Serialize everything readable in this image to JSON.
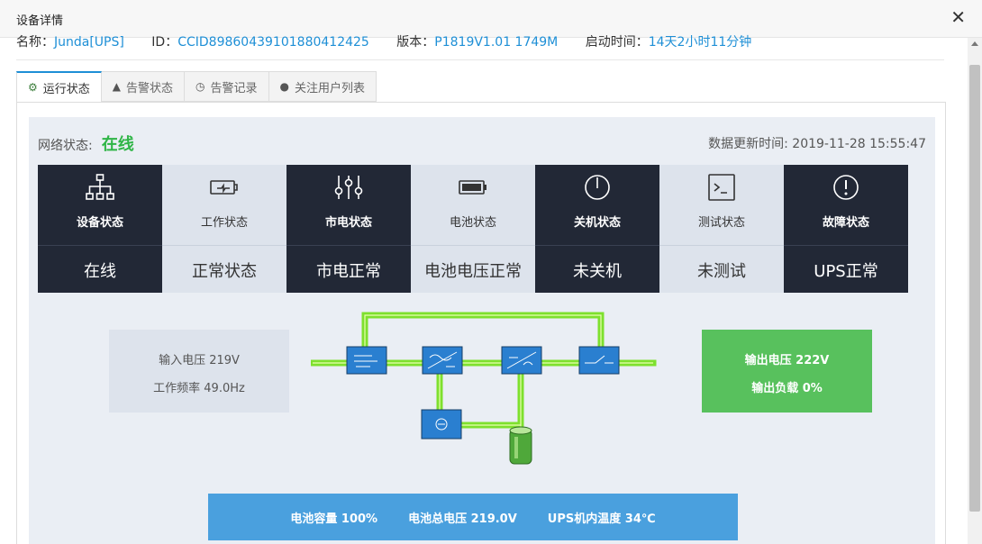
{
  "window": {
    "title": "设备详情",
    "close_icon": "close-icon"
  },
  "info": [
    {
      "label": "名称：",
      "value": "Junda[UPS]"
    },
    {
      "label": "ID：",
      "value": "CCID89860439101880412425"
    },
    {
      "label": "版本：",
      "value": "P1819V1.01 1749M"
    },
    {
      "label": "启动时间：",
      "value": "14天2小时11分钟"
    }
  ],
  "tabs": [
    {
      "label": "运行状态",
      "icon": "gears-icon"
    },
    {
      "label": "告警状态",
      "icon": "warning-icon"
    },
    {
      "label": "告警记录",
      "icon": "clock-icon"
    },
    {
      "label": "关注用户列表",
      "icon": "wechat-icon"
    }
  ],
  "network": {
    "label": "网络状态:",
    "value": "在线"
  },
  "update_time": "数据更新时间: 2019-11-28 15:55:47",
  "status_cells": [
    {
      "label": "设备状态",
      "value": "在线",
      "icon": "sitemap-icon",
      "theme": "dark"
    },
    {
      "label": "工作状态",
      "value": "正常状态",
      "icon": "battery-charge-icon",
      "theme": "light"
    },
    {
      "label": "市电状态",
      "value": "市电正常",
      "icon": "sliders-icon",
      "theme": "dark"
    },
    {
      "label": "电池状态",
      "value": "电池电压正常",
      "icon": "battery-icon",
      "theme": "light"
    },
    {
      "label": "关机状态",
      "value": "未关机",
      "icon": "power-icon",
      "theme": "dark"
    },
    {
      "label": "测试状态",
      "value": "未测试",
      "icon": "terminal-icon",
      "theme": "light"
    },
    {
      "label": "故障状态",
      "value": "UPS正常",
      "icon": "alert-circle-icon",
      "theme": "dark"
    }
  ],
  "input": {
    "voltage": "输入电压  219V",
    "frequency": "工作频率  49.0Hz"
  },
  "output": {
    "voltage": "输出电压  222V",
    "load": "输出负载  0%"
  },
  "diagram_colors": {
    "line": "#7ee02e",
    "box": "#2a7fd0"
  },
  "bottom": {
    "capacity": "电池容量  100%",
    "total_voltage": "电池总电压  219.0V",
    "temperature": "UPS机内温度  34℃"
  }
}
